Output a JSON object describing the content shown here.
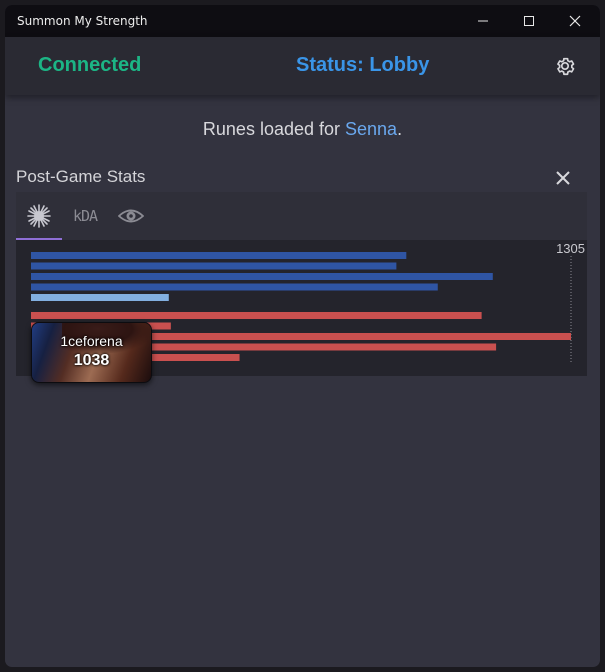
{
  "window": {
    "title": "Summon My Strength"
  },
  "header": {
    "connection": "Connected",
    "status": "Status: Lobby",
    "colors": {
      "connected": "#1cb585",
      "status": "#3a95e8"
    }
  },
  "runes": {
    "prefix": "Runes loaded for ",
    "champion": "Senna",
    "suffix": "."
  },
  "post_game": {
    "title": "Post-Game Stats",
    "tabs": [
      {
        "icon": "damage-burst-icon",
        "label": "",
        "active": true
      },
      {
        "icon": "kda-icon",
        "label": "kDA",
        "active": false
      },
      {
        "icon": "vision-eye-icon",
        "label": "",
        "active": false
      }
    ],
    "tooltip": {
      "name": "1ceforena",
      "value": "1038"
    }
  },
  "chart_data": {
    "type": "bar",
    "orientation": "horizontal",
    "max_label": "1305",
    "xlim": [
      0,
      1305
    ],
    "series": [
      {
        "team": "blue",
        "color": "#2f55a4",
        "values": [
          907,
          883,
          1116,
          983,
          333
        ],
        "highlight_color": "#82afe0",
        "highlight_index": 4
      },
      {
        "team": "red",
        "color": "#c9504f",
        "values": [
          1089,
          338,
          1305,
          1124,
          504
        ]
      }
    ]
  }
}
